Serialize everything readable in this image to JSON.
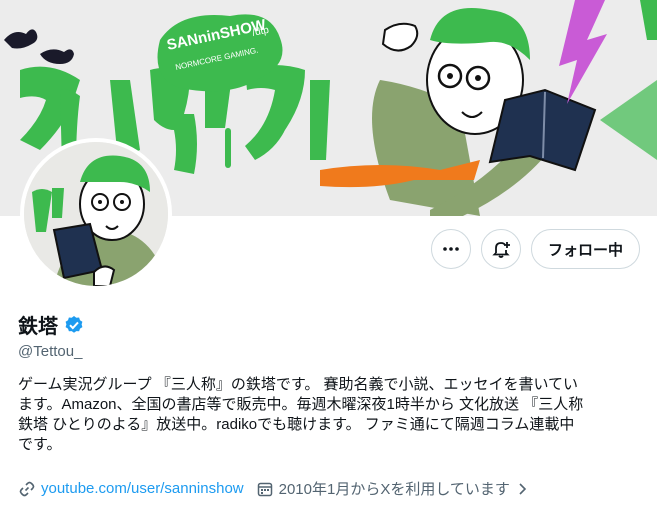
{
  "banner": {
    "sign_title": "SANninSHOW",
    "sign_suffix": "/dtp",
    "sign_sub": "NORMCORE GAMING."
  },
  "profile": {
    "display_name": "鉄塔",
    "handle": "@Tettou_",
    "bio_lines": [
      "ゲーム実況グループ 『三人称』の鉄塔です。 賽助名義で小説、エッセイを書いてい",
      "ます。Amazon、全国の書店等で販売中。毎週木曜深夜1時半から 文化放送 『三人称",
      "鉄塔 ひとりのよる』放送中。radikoでも聴けます。 ファミ通にて隔週コラム連載中",
      "です。"
    ],
    "website": "youtube.com/user/sanninshow",
    "joined": "2010年1月からXを利用しています"
  },
  "actions": {
    "more_icon": "more-icon",
    "notify_icon": "bell-plus-icon",
    "follow_label": "フォロー中"
  },
  "colors": {
    "accent_green": "#3dba4e",
    "link": "#1d9bf0",
    "verified": "#1d9bf0"
  }
}
